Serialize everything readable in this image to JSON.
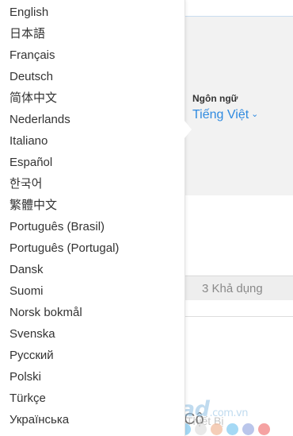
{
  "background": {
    "language_label": "Ngôn ngữ",
    "language_value": "Tiếng Việt",
    "availability_field": "3 Khả dụng",
    "partial_text": "Cộ"
  },
  "watermark": {
    "brand": "Download",
    "suffix": ".com.vn",
    "tagline": "Thiết Bị",
    "dot_colors": [
      "#8fd0f2",
      "#e4e4e4",
      "#f2c2a6",
      "#8fd0f2",
      "#a9b8e6",
      "#f28b8b"
    ]
  },
  "dropdown": {
    "items": [
      {
        "label": "English"
      },
      {
        "label": "日本語"
      },
      {
        "label": "Français"
      },
      {
        "label": "Deutsch"
      },
      {
        "label": "简体中文"
      },
      {
        "label": "Nederlands"
      },
      {
        "label": "Italiano"
      },
      {
        "label": "Español"
      },
      {
        "label": "한국어"
      },
      {
        "label": "繁體中文"
      },
      {
        "label": "Português (Brasil)"
      },
      {
        "label": "Português (Portugal)"
      },
      {
        "label": "Dansk"
      },
      {
        "label": "Suomi"
      },
      {
        "label": "Norsk bokmål"
      },
      {
        "label": "Svenska"
      },
      {
        "label": "Русский"
      },
      {
        "label": "Polski"
      },
      {
        "label": "Türkçe"
      },
      {
        "label": "Українська"
      }
    ]
  },
  "colors": {
    "accent": "#2f8ae0",
    "text": "#333333"
  },
  "icons": {
    "language_chevron": "chevron-down-icon"
  }
}
